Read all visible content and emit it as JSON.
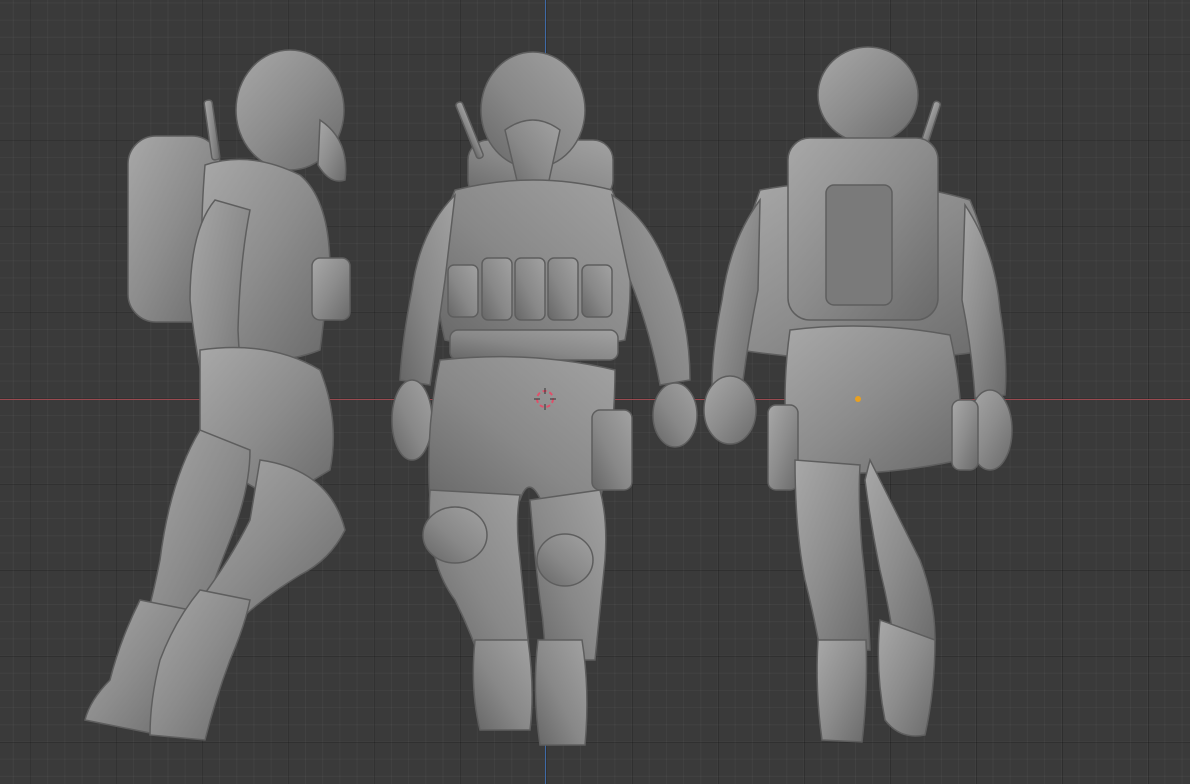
{
  "viewport": {
    "background_color": "#3a3a3a",
    "x_axis_color": "#9a4a50",
    "y_axis_color": "#3f6aa6",
    "grid": true
  },
  "scene": {
    "model_color": "#8a8a8a",
    "model_views": [
      "side",
      "front",
      "back"
    ],
    "cursor_color": "#e0506a",
    "origin_color": "#e8a020"
  }
}
